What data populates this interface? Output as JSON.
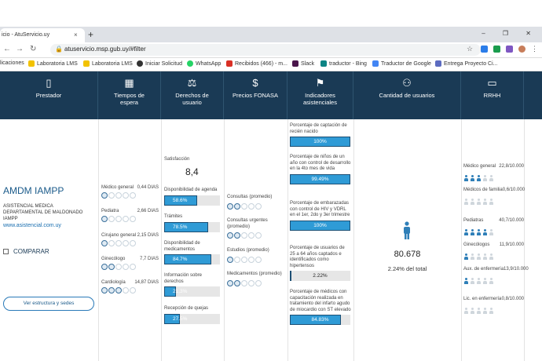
{
  "browser": {
    "tab_title": "icio - AtuServicio.uy",
    "close": "×",
    "new_tab": "+",
    "window_controls": "– ❐ ✕",
    "url": "atuservicio.msp.gub.uy/#filter",
    "bookmarks": [
      "licaciones",
      "Laboratoria LMS",
      "Laboratoria LMS",
      "Iniciar Solicitud",
      "WhatsApp",
      "Recibidos (466) - m...",
      "Slack",
      "traductor - Bing",
      "Traductor de Google",
      "Entrega Proyecto Ci..."
    ],
    "colors": {
      "tabbar": "#dee1e6",
      "accent": "#1a3a55"
    }
  },
  "header": {
    "columns": [
      {
        "label": "Prestador",
        "icon": "building-icon"
      },
      {
        "label": "Tiempos de espera",
        "icon": "calendar-icon"
      },
      {
        "label": "Derechos de usuario",
        "icon": "scales-icon"
      },
      {
        "label": "Precios FONASA",
        "icon": "money-icon"
      },
      {
        "label": "Indicadores asistenciales",
        "icon": "flag-icon"
      },
      {
        "label": "Cantidad de usuarios",
        "icon": "add-user-icon"
      },
      {
        "label": "RRHH",
        "icon": "folder-icon"
      }
    ]
  },
  "provider": {
    "name": "AMDM IAMPP",
    "full_name": "ASISTENCIAL MEDICA DEPARTAMENTAL DE MALDONADO IAMPP",
    "website": "www.asistencial.com.uy",
    "compare_label": "COMPARAR",
    "structure_button": "Ver estructura y sedes"
  },
  "wait_times": [
    {
      "label": "Médico general",
      "value": "0,44 DIAS",
      "filled": 1
    },
    {
      "label": "Pediatra",
      "value": "2,66 DIAS",
      "filled": 1
    },
    {
      "label": "Cirujano general",
      "value": "2,15 DIAS",
      "filled": 1
    },
    {
      "label": "Ginecólogo",
      "value": "7,7 DIAS",
      "filled": 2
    },
    {
      "label": "Cardiología",
      "value": "14,87 DIAS",
      "filled": 3
    }
  ],
  "rights": {
    "satisfaction_label": "Satisfacción",
    "satisfaction_value": "8,4",
    "items": [
      {
        "label": "Disponibilidad de agenda",
        "value": "58.6%",
        "pct": 58.6
      },
      {
        "label": "Trámites",
        "value": "78.5%",
        "pct": 78.5
      },
      {
        "label": "Disponibilidad de medicamentos",
        "value": "84.7%",
        "pct": 84.7
      },
      {
        "label": "Información sobre derechos",
        "value": "21.3%",
        "pct": 21.3
      },
      {
        "label": "Recepción de quejas",
        "value": "27.5%",
        "pct": 27.5
      }
    ]
  },
  "prices": [
    {
      "label": "Consultas (promedio)",
      "filled": 1
    },
    {
      "label": "Consultas urgentes (promedio)",
      "filled": 1
    },
    {
      "label": "Estudios (promedio)",
      "filled": 1
    },
    {
      "label": "Medicamentos (promedio)",
      "filled": 1
    }
  ],
  "indicators": [
    {
      "label": "Porcentaje de captación de recién nacido",
      "value": "100%",
      "pct": 100
    },
    {
      "label": "Porcentaje de niños de un año con control de desarrollo en la 4to mes de vida",
      "value": "99.49%",
      "pct": 99.49
    },
    {
      "label": "Porcentaje de embarazadas con control de HIV y VDRL en el 1er, 2do y 3er trimestre",
      "value": "100%",
      "pct": 100
    },
    {
      "label": "Porcentaje de usuarios de 25 a 64 años captados e identificados como hipertensos",
      "value": "2.22%",
      "pct": 2.22
    },
    {
      "label": "Porcentaje de médicos con capacitación realizada en tratamiento del infarto agudo de miocardio con ST elevado",
      "value": "84.83%",
      "pct": 84.83
    }
  ],
  "users": {
    "icon": "person-icon",
    "count": "80.678",
    "share": "2.24% del total"
  },
  "rrhh": [
    {
      "label": "Médico general",
      "value": "22,8/10.000",
      "filled": 3
    },
    {
      "label": "Médicos de familia",
      "value": "0,6/10.000",
      "filled": 0
    },
    {
      "label": "Pediatras",
      "value": "40,7/10.000",
      "filled": 4
    },
    {
      "label": "Ginecólogos",
      "value": "11,9/10.000",
      "filled": 1
    },
    {
      "label": "Aux. de enfermería",
      "value": "13,9/10.000",
      "filled": 1
    },
    {
      "label": "Lic. en enfermería",
      "value": "0,8/10.000",
      "filled": 0
    }
  ]
}
